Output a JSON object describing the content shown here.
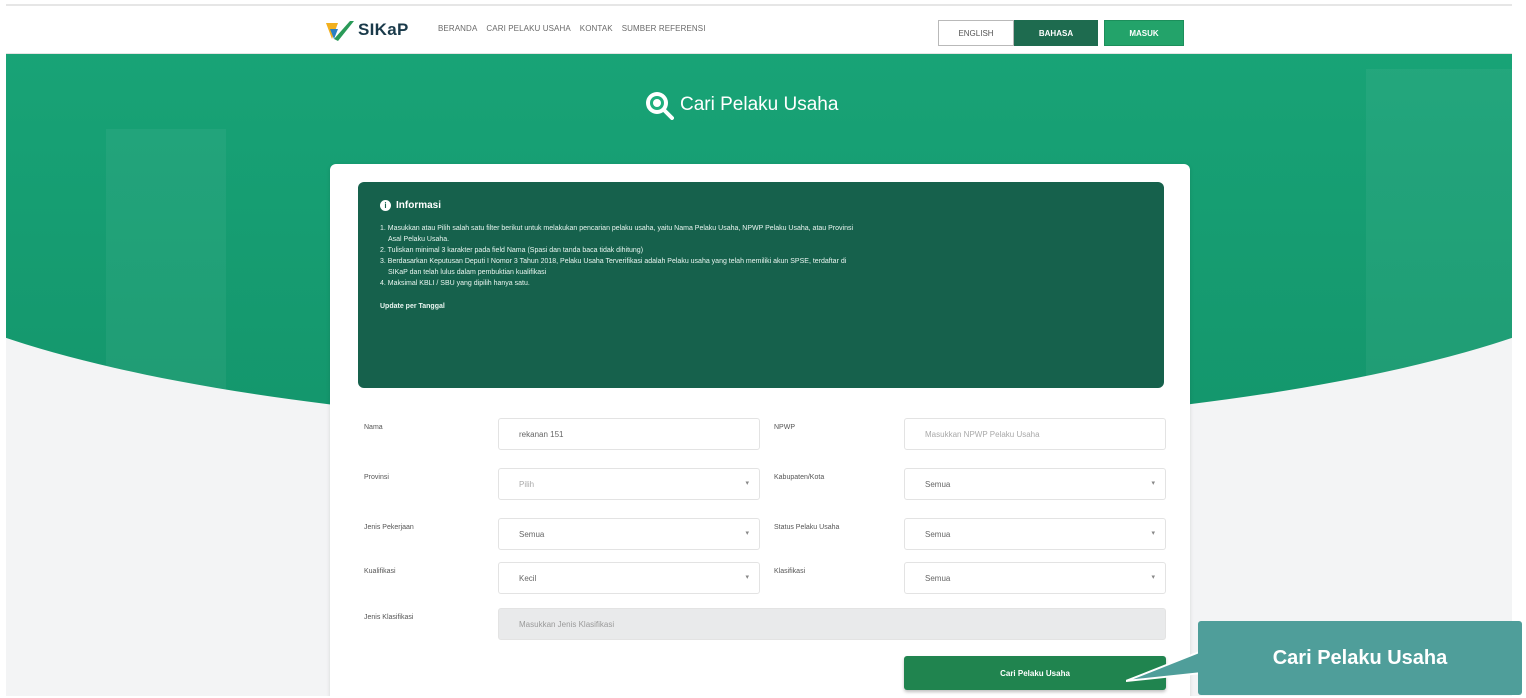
{
  "navbar": {
    "logo_text": "SIKaP",
    "links": [
      "BERANDA",
      "CARI PELAKU USAHA",
      "KONTAK",
      "SUMBER REFERENSI"
    ],
    "btn_english": "ENGLISH",
    "btn_bahasa": "BAHASA",
    "btn_masuk": "MASUK"
  },
  "hero": {
    "title": "Cari Pelaku Usaha"
  },
  "info": {
    "heading": "Informasi",
    "lines": [
      "1. Masukkan atau Pilih salah satu filter berikut untuk melakukan pencarian pelaku usaha, yaitu Nama Pelaku Usaha, NPWP Pelaku Usaha, atau Provinsi",
      "Asal Pelaku Usaha.",
      "2. Tuliskan minimal 3 karakter pada field Nama (Spasi dan tanda baca tidak dihitung)",
      "3. Berdasarkan Keputusan Deputi I Nomor 3 Tahun 2018, Pelaku Usaha Terverifikasi adalah Pelaku usaha yang telah memiliki akun SPSE, terdaftar di",
      "SIKaP dan telah lulus dalam pembuktian kualifikasi",
      "4. Maksimal KBLI / SBU yang dipilih hanya satu."
    ],
    "update": "Update per Tanggal"
  },
  "form": {
    "nama_label": "Nama",
    "nama_value": "rekanan 151",
    "npwp_label": "NPWP",
    "npwp_placeholder": "Masukkan NPWP Pelaku Usaha",
    "provinsi_label": "Provinsi",
    "provinsi_value": "Pilih",
    "kabupaten_label": "Kabupaten/Kota",
    "kabupaten_value": "Semua",
    "jenis_pekerjaan_label": "Jenis Pekerjaan",
    "jenis_pekerjaan_value": "Semua",
    "status_label": "Status Pelaku Usaha",
    "status_value": "Semua",
    "kualifikasi_label": "Kualifikasi",
    "kualifikasi_value": "Kecil",
    "klasifikasi_label": "Klasifikasi",
    "klasifikasi_value": "Semua",
    "jenis_klasifikasi_label": "Jenis Klasifikasi",
    "jenis_klasifikasi_placeholder": "Masukkan Jenis Klasifikasi",
    "search_button": "Cari Pelaku Usaha"
  },
  "callout": {
    "text": "Cari Pelaku Usaha"
  },
  "colors": {
    "brand_green": "#1faf7d",
    "info_bg": "#16614c",
    "button_green": "#20844f",
    "callout": "#4f9e9a"
  }
}
